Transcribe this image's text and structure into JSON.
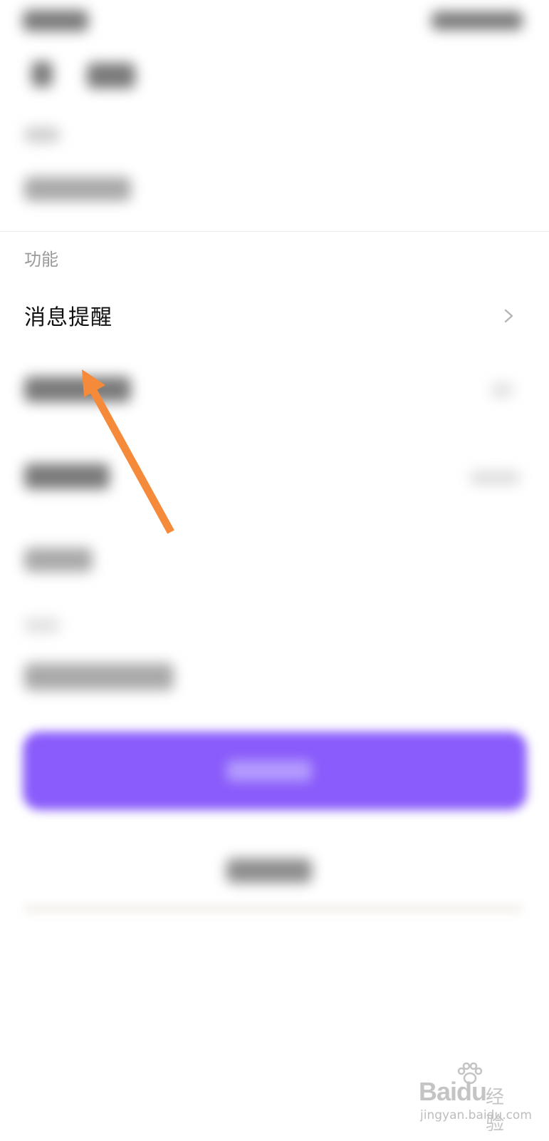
{
  "settings": {
    "section_label": "功能",
    "message_reminder_label": "消息提醒"
  },
  "annotation": {
    "arrow_color": "#f58a3a"
  },
  "watermark": {
    "logo_text": "Baidu",
    "logo_suffix": "经验",
    "url": "jingyan.baidu.com"
  },
  "colors": {
    "primary_button": "#8a5cfb"
  }
}
